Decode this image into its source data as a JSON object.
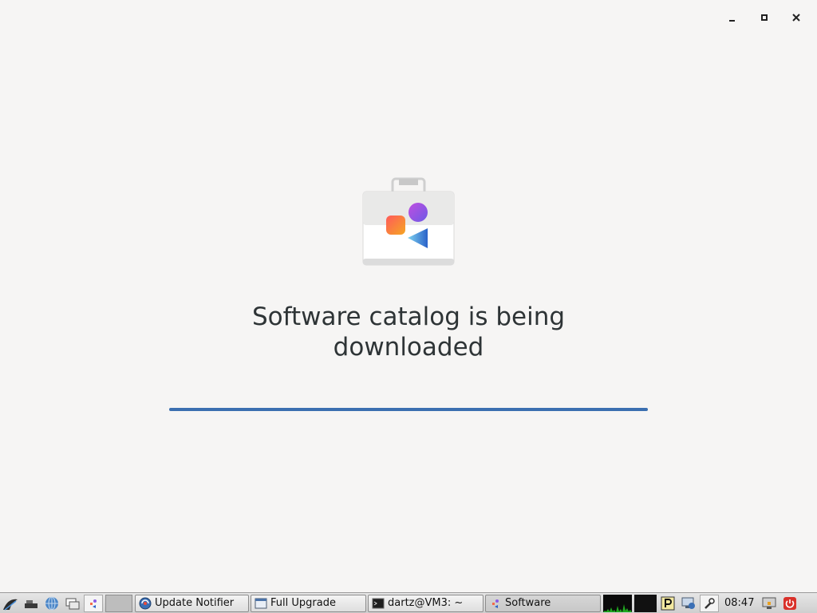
{
  "window": {
    "controls": {
      "minimize": "minimize",
      "maximize": "maximize",
      "close": "close"
    }
  },
  "main": {
    "headline": "Software catalog is being downloaded",
    "progress_fraction": 1.0
  },
  "taskbar": {
    "launchers": [
      "menu-icon",
      "desktop-icon",
      "browser-icon",
      "file-manager-icon",
      "software-icon"
    ],
    "tasks": [
      {
        "label": "Update Notifier",
        "icon": "update-icon"
      },
      {
        "label": "Full Upgrade",
        "icon": "window-icon"
      },
      {
        "label": "dartz@VM3: ~",
        "icon": "terminal-icon"
      },
      {
        "label": "Software",
        "icon": "software-icon"
      }
    ],
    "clock": "08:47"
  },
  "colors": {
    "background": "#f6f5f4",
    "progress": "#3b6fb0",
    "text": "#2e3436"
  }
}
